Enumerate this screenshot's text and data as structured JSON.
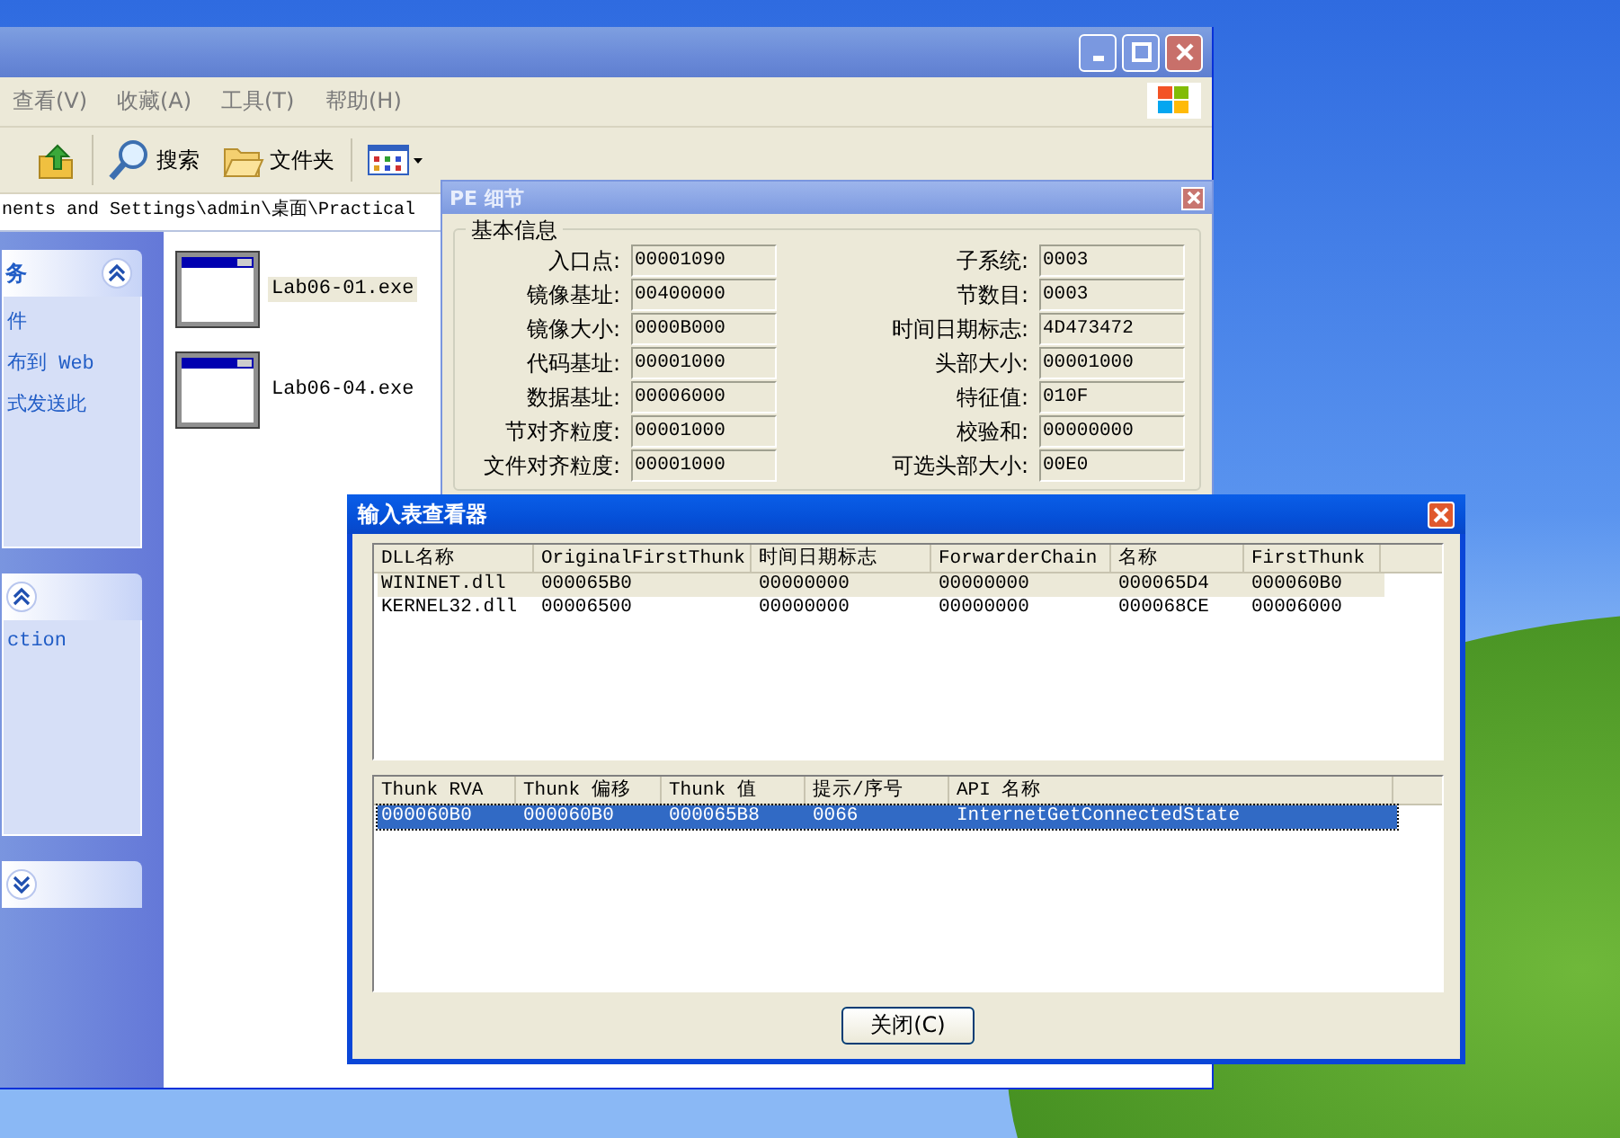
{
  "explorer": {
    "menu": [
      {
        "label": "查看(V)"
      },
      {
        "label": "收藏(A)"
      },
      {
        "label": "工具(T)"
      },
      {
        "label": "帮助(H)"
      }
    ],
    "toolbar": [
      {
        "kind": "up"
      },
      {
        "kind": "search",
        "label": "搜索"
      },
      {
        "kind": "folders",
        "label": "文件夹"
      },
      {
        "kind": "views"
      }
    ],
    "address": "nents and Settings\\admin\\桌面\\Practical",
    "task_panels": [
      {
        "title": "务",
        "expanded": true,
        "items": [
          "件",
          "布到 Web",
          "式发送此"
        ]
      },
      {
        "expanded": true,
        "items": [
          "ction"
        ]
      },
      {
        "expanded": false
      }
    ],
    "files": [
      {
        "name": "Lab06-01.exe",
        "selected": true
      },
      {
        "name": "Lab06-04.exe",
        "selected": false
      }
    ]
  },
  "pe_details": {
    "title": "PE 细节",
    "group": "基本信息",
    "left_fields": [
      {
        "label": "入口点:",
        "value": "00001090"
      },
      {
        "label": "镜像基址:",
        "value": "00400000"
      },
      {
        "label": "镜像大小:",
        "value": "0000B000"
      },
      {
        "label": "代码基址:",
        "value": "00001000"
      },
      {
        "label": "数据基址:",
        "value": "00006000"
      },
      {
        "label": "节对齐粒度:",
        "value": "00001000"
      },
      {
        "label": "文件对齐粒度:",
        "value": "00001000"
      }
    ],
    "right_fields": [
      {
        "label": "子系统:",
        "value": "0003"
      },
      {
        "label": "节数目:",
        "value": "0003"
      },
      {
        "label": "时间日期标志:",
        "value": "4D473472"
      },
      {
        "label": "头部大小:",
        "value": "00001000"
      },
      {
        "label": "特征值:",
        "value": "010F"
      },
      {
        "label": "校验和:",
        "value": "00000000"
      },
      {
        "label": "可选头部大小:",
        "value": "00E0"
      }
    ]
  },
  "import_viewer": {
    "title": "输入表查看器",
    "dll_table": {
      "focused": false,
      "columns": [
        "DLL名称",
        "OriginalFirstThunk",
        "时间日期标志",
        "ForwarderChain",
        "名称",
        "FirstThunk"
      ],
      "rows": [
        {
          "selected": true,
          "cells": [
            "WININET.dll",
            "000065B0",
            "00000000",
            "00000000",
            "000065D4",
            "000060B0"
          ]
        },
        {
          "selected": false,
          "cells": [
            "KERNEL32.dll",
            "00006500",
            "00000000",
            "00000000",
            "000068CE",
            "00006000"
          ]
        }
      ]
    },
    "thunk_table": {
      "focused": true,
      "columns": [
        "Thunk RVA",
        "Thunk 偏移",
        "Thunk 值",
        "提示/序号",
        "API 名称"
      ],
      "rows": [
        {
          "selected": true,
          "cells": [
            "000060B0",
            "000060B0",
            "000065B8",
            "0066",
            "InternetGetConnectedState"
          ]
        }
      ]
    },
    "close_button": "关闭(C)"
  }
}
